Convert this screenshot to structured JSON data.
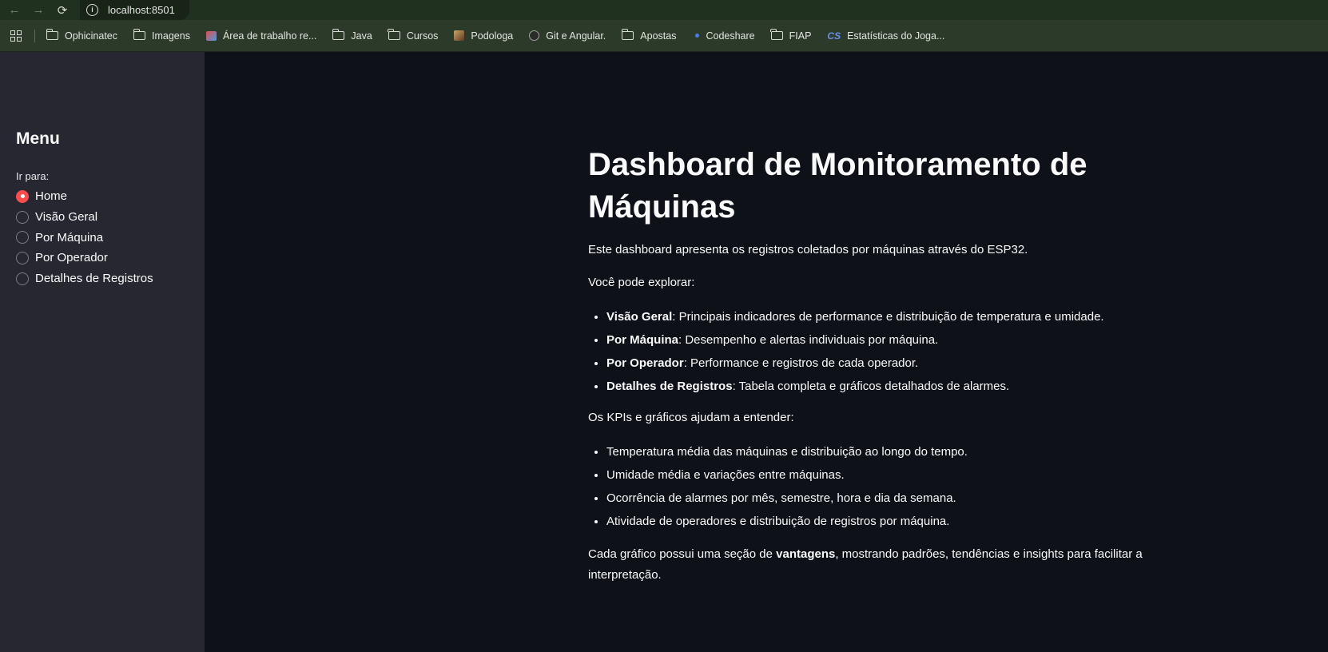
{
  "browser": {
    "url": "localhost:8501",
    "bookmarks": [
      {
        "label": "Ophicinatec",
        "icon": "folder-icon"
      },
      {
        "label": "Imagens",
        "icon": "folder-icon"
      },
      {
        "label": "Área de trabalho re...",
        "icon": "picture-icon"
      },
      {
        "label": "Java",
        "icon": "folder-icon"
      },
      {
        "label": "Cursos",
        "icon": "folder-icon"
      },
      {
        "label": "Podologa",
        "icon": "podologa-icon"
      },
      {
        "label": "Git e Angular.",
        "icon": "github-icon"
      },
      {
        "label": "Apostas",
        "icon": "folder-icon"
      },
      {
        "label": "Codeshare",
        "icon": "dot-icon"
      },
      {
        "label": "FIAP",
        "icon": "folder-icon"
      },
      {
        "label": "Estatísticas do Joga...",
        "icon": "cs-icon"
      }
    ]
  },
  "sidebar": {
    "title": "Menu",
    "radio_label": "Ir para:",
    "options": [
      "Home",
      "Visão Geral",
      "Por Máquina",
      "Por Operador",
      "Detalhes de Registros"
    ],
    "selected": "Home"
  },
  "main": {
    "title_line1": "Dashboard de Monitoramento de",
    "title_line2": "Máquinas",
    "intro": "Este dashboard apresenta os registros coletados por máquinas através do ESP32.",
    "explore_label": "Você pode explorar:",
    "explore_items": [
      {
        "bold": "Visão Geral",
        "text": ": Principais indicadores de performance e distribuição de temperatura e umidade."
      },
      {
        "bold": "Por Máquina",
        "text": ": Desempenho e alertas individuais por máquina."
      },
      {
        "bold": "Por Operador",
        "text": ": Performance e registros de cada operador."
      },
      {
        "bold": "Detalhes de Registros",
        "text": ": Tabela completa e gráficos detalhados de alarmes."
      }
    ],
    "kpi_label": "Os KPIs e gráficos ajudam a entender:",
    "kpi_items": [
      "Temperatura média das máquinas e distribuição ao longo do tempo.",
      "Umidade média e variações entre máquinas.",
      "Ocorrência de alarmes por mês, semestre, hora e dia da semana.",
      "Atividade de operadores e distribuição de registros por máquina."
    ],
    "closing_pre": "Cada gráfico possui uma seção de ",
    "closing_bold": "vantagens",
    "closing_post": ", mostrando padrões, tendências e insights para facilitar a interpretação."
  },
  "colors": {
    "accent": "#ff4b4b",
    "sidebar_bg": "#262730",
    "main_bg": "#0e1117",
    "browser_bar": "#2c3b29"
  }
}
